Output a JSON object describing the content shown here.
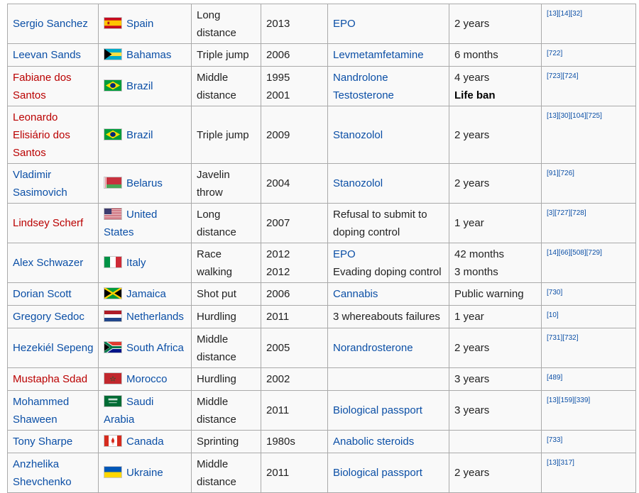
{
  "rows": [
    {
      "athlete": "Sergio Sanchez",
      "athlete_red": false,
      "country": "Spain",
      "flag": "spain-flag-icon",
      "event": "Long distance",
      "years": [
        "2013"
      ],
      "offences": [
        {
          "text": "EPO",
          "link": true
        }
      ],
      "penalties": [
        {
          "text": "2 years",
          "bold": false
        }
      ],
      "refs": "[13][14][32]"
    },
    {
      "athlete": "Leevan Sands",
      "athlete_red": false,
      "country": "Bahamas",
      "flag": "bahamas-flag-icon",
      "event": "Triple jump",
      "years": [
        "2006"
      ],
      "offences": [
        {
          "text": "Levmetamfetamine",
          "link": true
        }
      ],
      "penalties": [
        {
          "text": "6 months",
          "bold": false
        }
      ],
      "refs": "[722]"
    },
    {
      "athlete": "Fabiane dos Santos",
      "athlete_red": true,
      "country": "Brazil",
      "flag": "brazil-flag-icon",
      "event": "Middle distance",
      "years": [
        "1995",
        "2001"
      ],
      "offences": [
        {
          "text": "Nandrolone",
          "link": true
        },
        {
          "text": "Testosterone",
          "link": true
        }
      ],
      "penalties": [
        {
          "text": "4 years",
          "bold": false
        },
        {
          "text": "Life ban",
          "bold": true
        }
      ],
      "refs": "[723][724]"
    },
    {
      "athlete": "Leonardo Elisiário dos Santos",
      "athlete_red": true,
      "country": "Brazil",
      "flag": "brazil-flag-icon",
      "event": "Triple jump",
      "years": [
        "2009"
      ],
      "offences": [
        {
          "text": "Stanozolol",
          "link": true
        }
      ],
      "penalties": [
        {
          "text": "2 years",
          "bold": false
        }
      ],
      "refs": "[13][30][104][725]"
    },
    {
      "athlete": "Vladimir Sasimovich",
      "athlete_red": false,
      "country": "Belarus",
      "flag": "belarus-flag-icon",
      "event": "Javelin throw",
      "years": [
        "2004"
      ],
      "offences": [
        {
          "text": "Stanozolol",
          "link": true
        }
      ],
      "penalties": [
        {
          "text": "2 years",
          "bold": false
        }
      ],
      "refs": "[91][726]"
    },
    {
      "athlete": "Lindsey Scherf",
      "athlete_red": true,
      "country": "United States",
      "flag": "usa-flag-icon",
      "event": "Long distance",
      "years": [
        "2007"
      ],
      "offences": [
        {
          "text": "Refusal to submit to doping control",
          "link": false
        }
      ],
      "penalties": [
        {
          "text": "1 year",
          "bold": false
        }
      ],
      "refs": "[3][727][728]"
    },
    {
      "athlete": "Alex Schwazer",
      "athlete_red": false,
      "country": "Italy",
      "flag": "italy-flag-icon",
      "event": "Race walking",
      "years": [
        "2012",
        "2012"
      ],
      "offences": [
        {
          "text": "EPO",
          "link": true
        },
        {
          "text": "Evading doping control",
          "link": false
        }
      ],
      "penalties": [
        {
          "text": "42 months",
          "bold": false
        },
        {
          "text": "3 months",
          "bold": false
        }
      ],
      "refs": "[14][66][508][729]"
    },
    {
      "athlete": "Dorian Scott",
      "athlete_red": false,
      "country": "Jamaica",
      "flag": "jamaica-flag-icon",
      "event": "Shot put",
      "years": [
        "2006"
      ],
      "offences": [
        {
          "text": "Cannabis",
          "link": true
        }
      ],
      "penalties": [
        {
          "text": "Public warning",
          "bold": false
        }
      ],
      "refs": "[730]"
    },
    {
      "athlete": "Gregory Sedoc",
      "athlete_red": false,
      "country": "Netherlands",
      "flag": "netherlands-flag-icon",
      "event": "Hurdling",
      "years": [
        "2011"
      ],
      "offences": [
        {
          "text": "3 whereabouts failures",
          "link": false
        }
      ],
      "penalties": [
        {
          "text": "1 year",
          "bold": false
        }
      ],
      "refs": "[10]"
    },
    {
      "athlete": "Hezekiél Sepeng",
      "athlete_red": false,
      "country": "South Africa",
      "flag": "south-africa-flag-icon",
      "event": "Middle distance",
      "years": [
        "2005"
      ],
      "offences": [
        {
          "text": "Norandrosterone",
          "link": true
        }
      ],
      "penalties": [
        {
          "text": "2 years",
          "bold": false
        }
      ],
      "refs": "[731][732]"
    },
    {
      "athlete": "Mustapha Sdad",
      "athlete_red": true,
      "country": "Morocco",
      "flag": "morocco-flag-icon",
      "event": "Hurdling",
      "years": [
        "2002"
      ],
      "offences": [],
      "penalties": [
        {
          "text": "3 years",
          "bold": false
        }
      ],
      "refs": "[489]"
    },
    {
      "athlete": "Mohammed Shaween",
      "athlete_red": false,
      "country": "Saudi Arabia",
      "flag": "saudi-arabia-flag-icon",
      "event": "Middle distance",
      "years": [
        "2011"
      ],
      "offences": [
        {
          "text": "Biological passport",
          "link": true
        }
      ],
      "penalties": [
        {
          "text": "3 years",
          "bold": false
        }
      ],
      "refs": "[13][159][339]"
    },
    {
      "athlete": "Tony Sharpe",
      "athlete_red": false,
      "country": "Canada",
      "flag": "canada-flag-icon",
      "event": "Sprinting",
      "years": [
        "1980s"
      ],
      "offences": [
        {
          "text": "Anabolic steroids",
          "link": true
        }
      ],
      "penalties": [],
      "refs": "[733]"
    },
    {
      "athlete": "Anzhelika Shevchenko",
      "athlete_red": false,
      "country": "Ukraine",
      "flag": "ukraine-flag-icon",
      "event": "Middle distance",
      "years": [
        "2011"
      ],
      "offences": [
        {
          "text": "Biological passport",
          "link": true
        }
      ],
      "penalties": [
        {
          "text": "2 years",
          "bold": false
        }
      ],
      "refs": "[13][317]"
    }
  ]
}
